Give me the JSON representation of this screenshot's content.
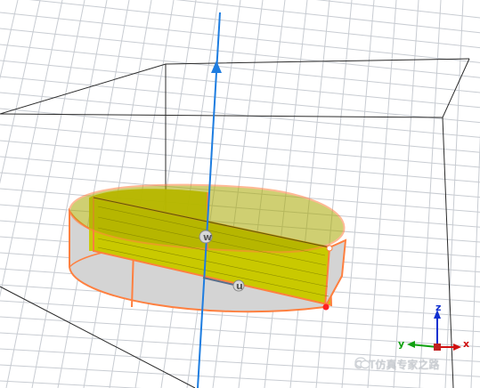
{
  "viewport": {
    "background": "#ffffff",
    "grid_color": "#c8ccd2",
    "bounding_box_color": "#2b2b2b",
    "axis_color": "#1e7de0",
    "highlight_color": "#ff8040",
    "solid_fill": "#c9c900",
    "cylinder_fill": "#d4d4d4"
  },
  "wcs_labels": {
    "w": "w",
    "u": "u"
  },
  "orientation_axes": {
    "x": "x",
    "y": "y",
    "z": "z",
    "x_color": "#d01010",
    "y_color": "#10a010",
    "z_color": "#1030d0"
  },
  "watermark": {
    "icon": "wechat-icon",
    "text": "CST仿真专家之路"
  }
}
